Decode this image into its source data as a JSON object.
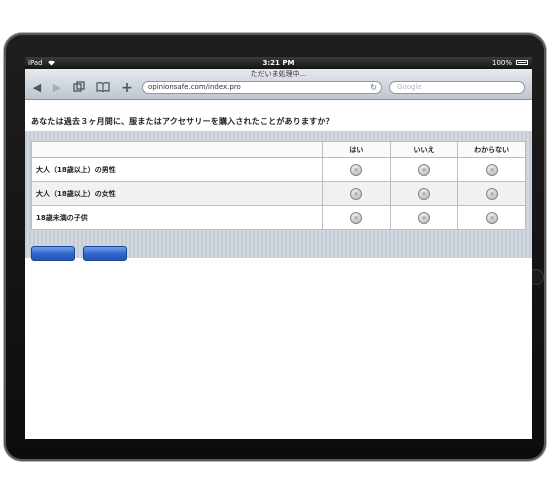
{
  "status_bar": {
    "carrier": "iPad",
    "wifi_icon": "wifi-icon",
    "time": "3:21 PM",
    "battery": "100%"
  },
  "browser": {
    "page_title": "ただいま処理中...",
    "url": "opinionsafe.com/index.pro",
    "search_placeholder": "Google",
    "icons": [
      "back-icon",
      "forward-icon",
      "tabs-icon",
      "bookmarks-icon",
      "add-icon",
      "reload-icon"
    ]
  },
  "survey": {
    "question": "あなたは過去３ヶ月間に、服またはアクセサリーを購入されたことがありますか？",
    "columns": [
      "はい",
      "いいえ",
      "わからない"
    ],
    "rows": [
      {
        "label": "大人（18歳以上）の男性"
      },
      {
        "label": "大人（18歳以上）の女性"
      },
      {
        "label": "18歳未満の子供"
      }
    ],
    "buttons": [
      "",
      ""
    ]
  },
  "colors": {
    "button_blue": "#2f63c8",
    "panel_stripe": "#c5ccd6"
  }
}
